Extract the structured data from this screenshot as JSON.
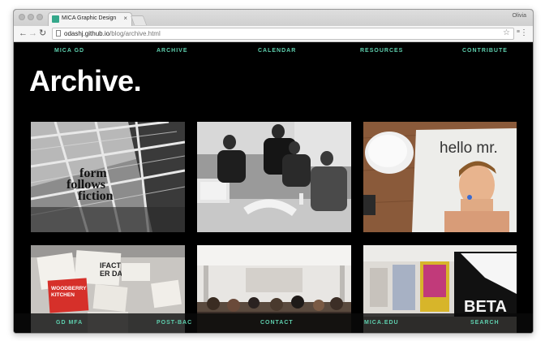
{
  "browser": {
    "tab_title": "MICA Graphic Design",
    "tab_close": "×",
    "profile_name": "Olivia",
    "url_host": "odashj.github.io",
    "url_path": "/blog/archive.html",
    "ext_label": "≡",
    "favicon_color": "#35a88b"
  },
  "top_nav": {
    "items": [
      "MICA GD",
      "ARCHIVE",
      "CALENDAR",
      "RESOURCES",
      "CONTRIBUTE"
    ]
  },
  "page": {
    "heading": "Archive.",
    "accent_color": "#5ecfae"
  },
  "thumbnails": [
    {
      "name": "thumb-form-follows-fiction",
      "caption": "form follows fiction"
    },
    {
      "name": "thumb-studio-group"
    },
    {
      "name": "thumb-hello-mr",
      "caption": "hello mr."
    },
    {
      "name": "thumb-posters",
      "caption": "WOODBERRY KITCHEN"
    },
    {
      "name": "thumb-gallery-crowd"
    },
    {
      "name": "thumb-poster-exhibit",
      "caption": "BETA"
    }
  ],
  "bottom_nav": {
    "items": [
      "GD MFA",
      "POST-BAC",
      "CONTACT",
      "MICA.EDU",
      "SEARCH"
    ]
  }
}
